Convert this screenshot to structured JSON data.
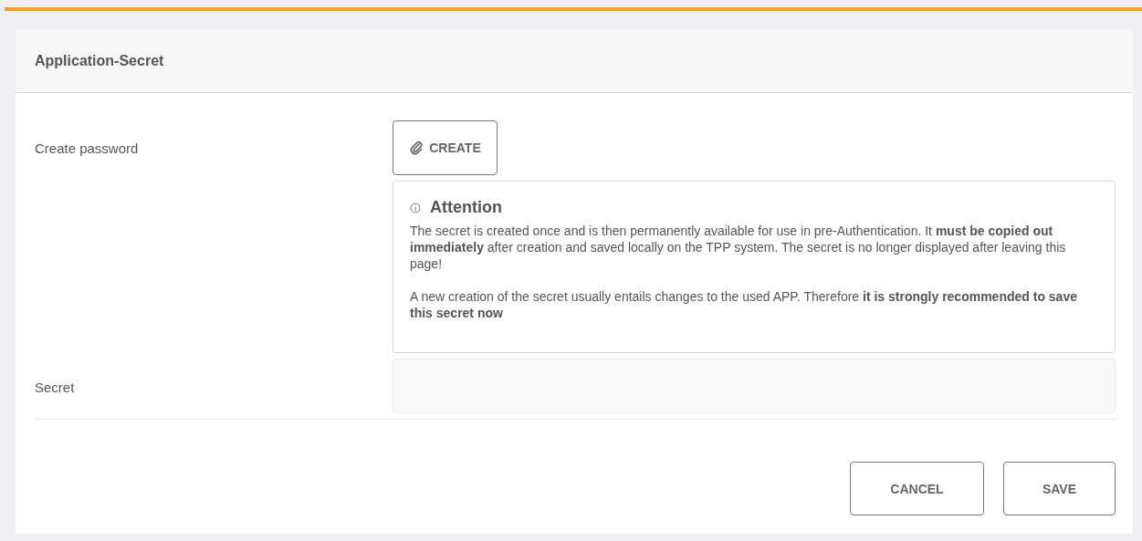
{
  "card": {
    "title": "Application-Secret"
  },
  "create_row": {
    "label": "Create password",
    "button": "CREATE"
  },
  "attention": {
    "title": "Attention",
    "paragraphs": [
      "The secret is created once and is then permanently available for use in pre-Authentication. It **must be copied out immediately** after creation and saved locally on the TPP system. The secret is no longer displayed after leaving this page!",
      "A new creation of the secret usually entails changes to the used APP. Therefore **it is strongly recommended to save this secret now**"
    ]
  },
  "secret_row": {
    "label": "Secret",
    "readonly": true
  },
  "buttons": [
    "CANCEL",
    "SAVE"
  ]
}
